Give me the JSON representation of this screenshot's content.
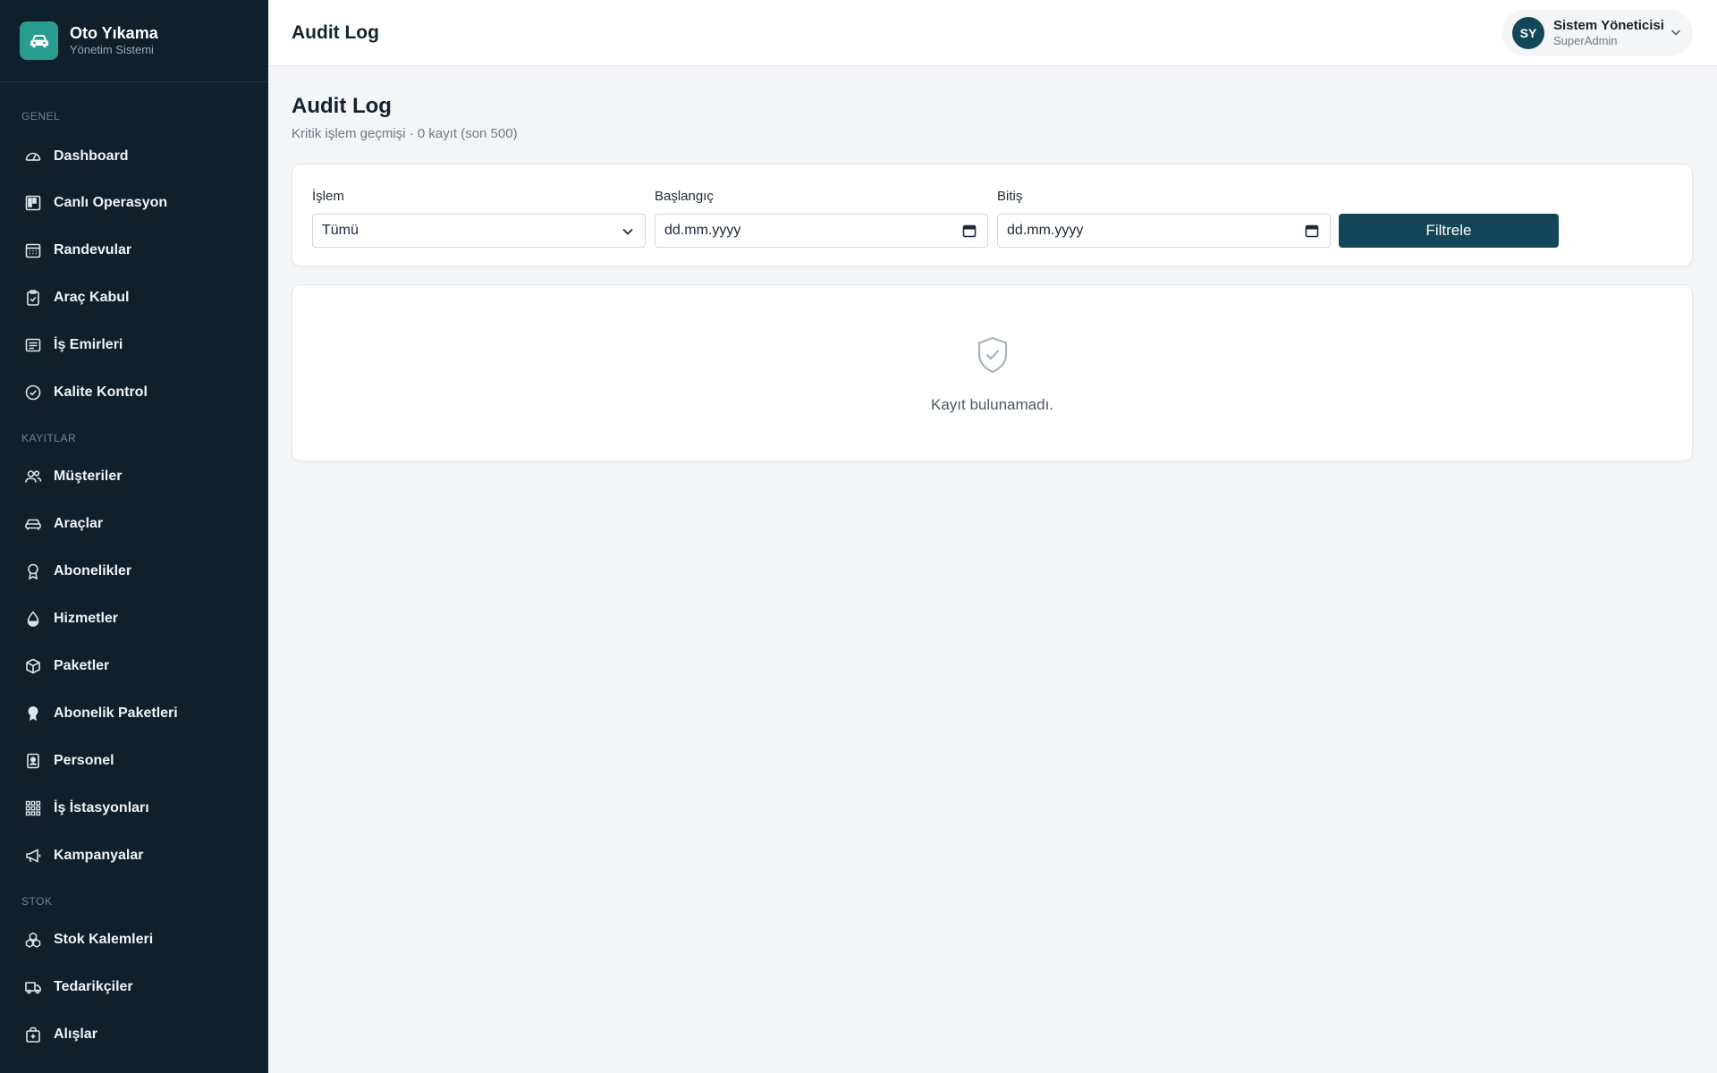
{
  "brand": {
    "title": "Oto Yıkama",
    "subtitle": "Yönetim Sistemi",
    "icon": "car-icon"
  },
  "sidebar": {
    "sections": [
      {
        "title": "GENEL",
        "items": [
          {
            "label": "Dashboard",
            "icon": "dashboard-gauge-icon"
          },
          {
            "label": "Canlı Operasyon",
            "icon": "kanban-icon"
          },
          {
            "label": "Randevular",
            "icon": "calendar-icon"
          },
          {
            "label": "Araç Kabul",
            "icon": "clipboard-check-icon"
          },
          {
            "label": "İş Emirleri",
            "icon": "list-icon"
          },
          {
            "label": "Kalite Kontrol",
            "icon": "check-circle-icon"
          }
        ]
      },
      {
        "title": "KAYITLAR",
        "items": [
          {
            "label": "Müşteriler",
            "icon": "users-icon"
          },
          {
            "label": "Araçlar",
            "icon": "car-icon"
          },
          {
            "label": "Abonelikler",
            "icon": "award-icon"
          },
          {
            "label": "Hizmetler",
            "icon": "droplet-icon"
          },
          {
            "label": "Paketler",
            "icon": "box-icon"
          },
          {
            "label": "Abonelik Paketleri",
            "icon": "award-filled-icon"
          },
          {
            "label": "Personel",
            "icon": "badge-icon"
          },
          {
            "label": "İş İstasyonları",
            "icon": "grid-icon"
          },
          {
            "label": "Kampanyalar",
            "icon": "megaphone-icon"
          }
        ]
      },
      {
        "title": "STOK",
        "items": [
          {
            "label": "Stok Kalemleri",
            "icon": "boxes-icon"
          },
          {
            "label": "Tedarikçiler",
            "icon": "truck-icon"
          },
          {
            "label": "Alışlar",
            "icon": "bag-plus-icon"
          }
        ]
      }
    ]
  },
  "header": {
    "title": "Audit Log",
    "user": {
      "initials": "SY",
      "name": "Sistem Yöneticisi",
      "role": "SuperAdmin"
    }
  },
  "main": {
    "title": "Audit Log",
    "subtitle": "Kritik işlem geçmişi · 0 kayıt (son 500)",
    "filters": {
      "operation_label": "İşlem",
      "operation_value": "Tümü",
      "start_label": "Başlangıç",
      "start_value": "dd.mm.yyyy",
      "end_label": "Bitiş",
      "end_value": "dd.mm.yyyy",
      "button": "Filtrele"
    },
    "empty": {
      "text": "Kayıt bulunamadı.",
      "icon": "shield-check-icon"
    }
  },
  "colors": {
    "sidebar_bg": "#0f1f2b",
    "accent": "#2a9d91",
    "primary": "#134656",
    "page_bg": "#f3f5f7"
  }
}
